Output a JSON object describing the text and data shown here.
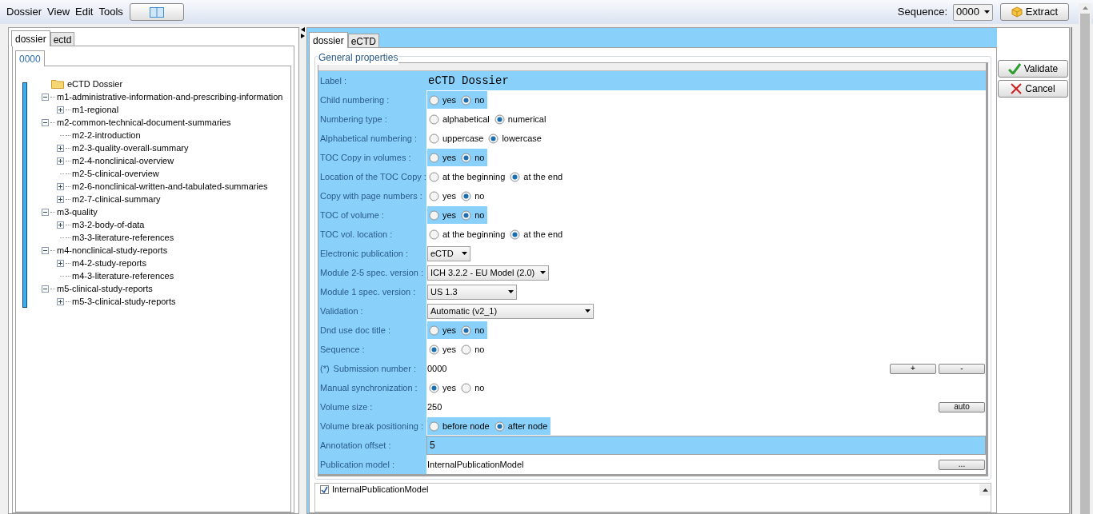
{
  "menu": [
    "Dossier",
    "View",
    "Edit",
    "Tools"
  ],
  "sequence": {
    "label": "Sequence:",
    "value": "0000"
  },
  "extract_button": "Extract",
  "left_tabs": [
    {
      "label": "dossier",
      "selected": true
    },
    {
      "label": "ectd",
      "selected": false
    }
  ],
  "sequence_tabs": [
    {
      "label": "0000",
      "selected": true
    }
  ],
  "tree": {
    "label": "eCTD Dossier",
    "children": [
      {
        "label": "m1-administrative-information-and-prescribing-information",
        "expanded": true,
        "children": [
          {
            "label": "m1-regional",
            "kind": "collapsed"
          }
        ]
      },
      {
        "label": "m2-common-technical-document-summaries",
        "expanded": true,
        "children": [
          {
            "label": "m2-2-introduction",
            "kind": "leaf"
          },
          {
            "label": "m2-3-quality-overall-summary",
            "kind": "collapsed"
          },
          {
            "label": "m2-4-nonclinical-overview",
            "kind": "collapsed"
          },
          {
            "label": "m2-5-clinical-overview",
            "kind": "leaf"
          },
          {
            "label": "m2-6-nonclinical-written-and-tabulated-summaries",
            "kind": "collapsed"
          },
          {
            "label": "m2-7-clinical-summary",
            "kind": "collapsed"
          }
        ]
      },
      {
        "label": "m3-quality",
        "expanded": true,
        "children": [
          {
            "label": "m3-2-body-of-data",
            "kind": "collapsed"
          },
          {
            "label": "m3-3-literature-references",
            "kind": "leaf"
          }
        ]
      },
      {
        "label": "m4-nonclinical-study-reports",
        "expanded": true,
        "children": [
          {
            "label": "m4-2-study-reports",
            "kind": "collapsed"
          },
          {
            "label": "m4-3-literature-references",
            "kind": "leaf"
          }
        ]
      },
      {
        "label": "m5-clinical-study-reports",
        "expanded": true,
        "children": [
          {
            "label": "m5-3-clinical-study-reports",
            "kind": "collapsed"
          }
        ]
      }
    ]
  },
  "right_tabs": [
    {
      "label": "dossier",
      "selected": true
    },
    {
      "label": "eCTD",
      "selected": false
    }
  ],
  "group_title": "General properties",
  "properties": [
    {
      "kind": "text",
      "label": "Label :",
      "value": "eCTD Dossier",
      "highlighted": true
    },
    {
      "kind": "radio",
      "label": "Child numbering :",
      "highlighted": true,
      "options": [
        {
          "label": "yes",
          "selected": false
        },
        {
          "label": "no",
          "selected": true
        }
      ]
    },
    {
      "kind": "radio",
      "label": "Numbering type :",
      "highlighted": false,
      "options": [
        {
          "label": "alphabetical",
          "selected": false
        },
        {
          "label": "numerical",
          "selected": true
        }
      ]
    },
    {
      "kind": "radio",
      "label": "Alphabetical numbering :",
      "highlighted": false,
      "options": [
        {
          "label": "uppercase",
          "selected": false
        },
        {
          "label": "lowercase",
          "selected": true
        }
      ]
    },
    {
      "kind": "radio",
      "label": "TOC Copy in volumes :",
      "highlighted": true,
      "options": [
        {
          "label": "yes",
          "selected": false
        },
        {
          "label": "no",
          "selected": true
        }
      ]
    },
    {
      "kind": "radio",
      "label": "Location of the TOC Copy :",
      "highlighted": false,
      "options": [
        {
          "label": "at the beginning",
          "selected": false
        },
        {
          "label": "at the end",
          "selected": true
        }
      ]
    },
    {
      "kind": "radio",
      "label": "Copy with page numbers :",
      "highlighted": false,
      "options": [
        {
          "label": "yes",
          "selected": false
        },
        {
          "label": "no",
          "selected": true
        }
      ]
    },
    {
      "kind": "radio",
      "label": "TOC of volume :",
      "highlighted": true,
      "options": [
        {
          "label": "yes",
          "selected": false
        },
        {
          "label": "no",
          "selected": true
        }
      ]
    },
    {
      "kind": "radio",
      "label": "TOC vol. location :",
      "highlighted": false,
      "options": [
        {
          "label": "at the beginning",
          "selected": false
        },
        {
          "label": "at the end",
          "selected": true
        }
      ]
    },
    {
      "kind": "select",
      "label": "Electronic publication :",
      "value": "eCTD"
    },
    {
      "kind": "select",
      "label": "Module 2-5 spec. version :",
      "value": "ICH 3.2.2 - EU Model (2.0)"
    },
    {
      "kind": "select",
      "label": "Module 1 spec. version :",
      "value": "US 1.3"
    },
    {
      "kind": "select",
      "label": "Validation :",
      "value": "Automatic (v2_1)"
    },
    {
      "kind": "radio",
      "label": "Dnd use doc title :",
      "highlighted": true,
      "options": [
        {
          "label": "yes",
          "selected": false
        },
        {
          "label": "no",
          "selected": true
        }
      ]
    },
    {
      "kind": "radio",
      "label": "Sequence :",
      "highlighted": false,
      "options": [
        {
          "label": "yes",
          "selected": true
        },
        {
          "label": "no",
          "selected": false
        }
      ]
    },
    {
      "kind": "value",
      "label": "Submission number :",
      "prefix": "(*)",
      "value": "0000",
      "buttons": [
        "+",
        "-"
      ]
    },
    {
      "kind": "radio",
      "label": "Manual synchronization :",
      "highlighted": false,
      "options": [
        {
          "label": "yes",
          "selected": true
        },
        {
          "label": "no",
          "selected": false
        }
      ]
    },
    {
      "kind": "value",
      "label": "Volume size :",
      "value": "250",
      "buttons": [
        "auto"
      ]
    },
    {
      "kind": "radio",
      "label": "Volume break positioning :",
      "highlighted": true,
      "options": [
        {
          "label": "before node",
          "selected": false
        },
        {
          "label": "after node",
          "selected": true
        }
      ]
    },
    {
      "kind": "input",
      "label": "Annotation offset :",
      "value": "5"
    },
    {
      "kind": "value",
      "label": "Publication model :",
      "value": "InternalPublicationModel",
      "buttons": [
        "..."
      ]
    }
  ],
  "model_item": {
    "label": "InternalPublicationModel",
    "checked": true
  },
  "action_buttons": [
    {
      "kind": "validate",
      "label": "Validate"
    },
    {
      "kind": "cancel",
      "label": "Cancel"
    }
  ]
}
